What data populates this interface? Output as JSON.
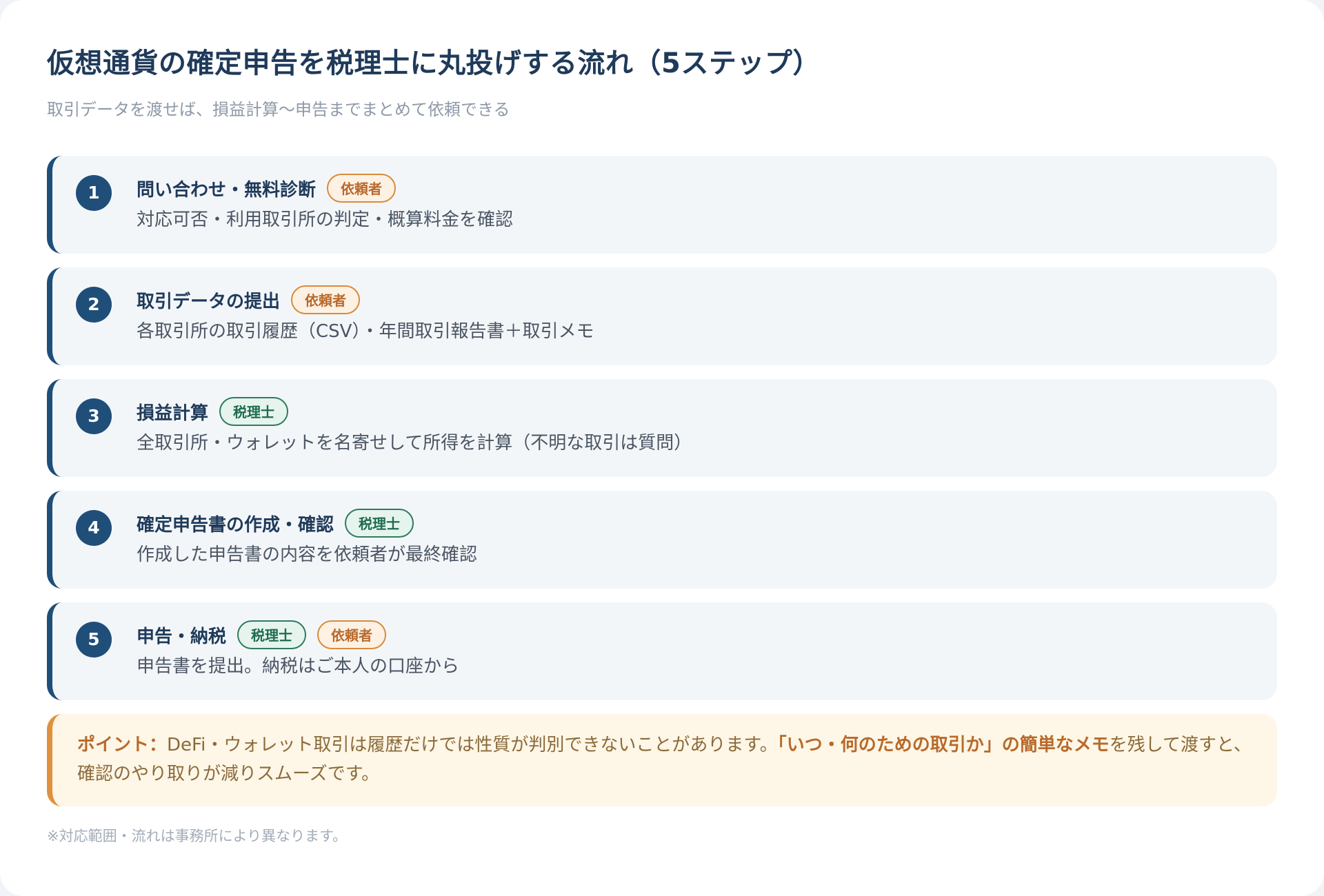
{
  "header": {
    "title": "仮想通貨の確定申告を税理士に丸投げする流れ（5ステップ）",
    "subtitle": "取引データを渡せば、損益計算〜申告までまとめて依頼できる"
  },
  "steps": [
    {
      "number": "1",
      "title": "問い合わせ・無料診断",
      "badges": [
        {
          "label": "依頼者",
          "kind": "client"
        }
      ],
      "description": "対応可否・利用取引所の判定・概算料金を確認"
    },
    {
      "number": "2",
      "title": "取引データの提出",
      "badges": [
        {
          "label": "依頼者",
          "kind": "client"
        }
      ],
      "description": "各取引所の取引履歴（CSV）・年間取引報告書＋取引メモ"
    },
    {
      "number": "3",
      "title": "損益計算",
      "badges": [
        {
          "label": "税理士",
          "kind": "tax"
        }
      ],
      "description": "全取引所・ウォレットを名寄せして所得を計算（不明な取引は質問）"
    },
    {
      "number": "4",
      "title": "確定申告書の作成・確認",
      "badges": [
        {
          "label": "税理士",
          "kind": "tax"
        }
      ],
      "description": "作成した申告書の内容を依頼者が最終確認"
    },
    {
      "number": "5",
      "title": "申告・納税",
      "badges": [
        {
          "label": "税理士",
          "kind": "tax"
        },
        {
          "label": "依頼者",
          "kind": "client"
        }
      ],
      "description": "申告書を提出。納税はご本人の口座から"
    }
  ],
  "point": {
    "lead": "ポイント：",
    "text_before": "DeFi・ウォレット取引は履歴だけでは性質が判別できないことがあります。",
    "emphasis": "「いつ・何のための取引か」の簡単なメモ",
    "text_after": "を残して渡すと、確認のやり取りが減りスムーズです。"
  },
  "footnote": "※対応範囲・流れは事務所により異なります。",
  "colors": {
    "accent_navy": "#1f4e79",
    "client_orange": "#d98b3a",
    "tax_green": "#2e7b5e",
    "point_bg": "#fef6e6"
  }
}
